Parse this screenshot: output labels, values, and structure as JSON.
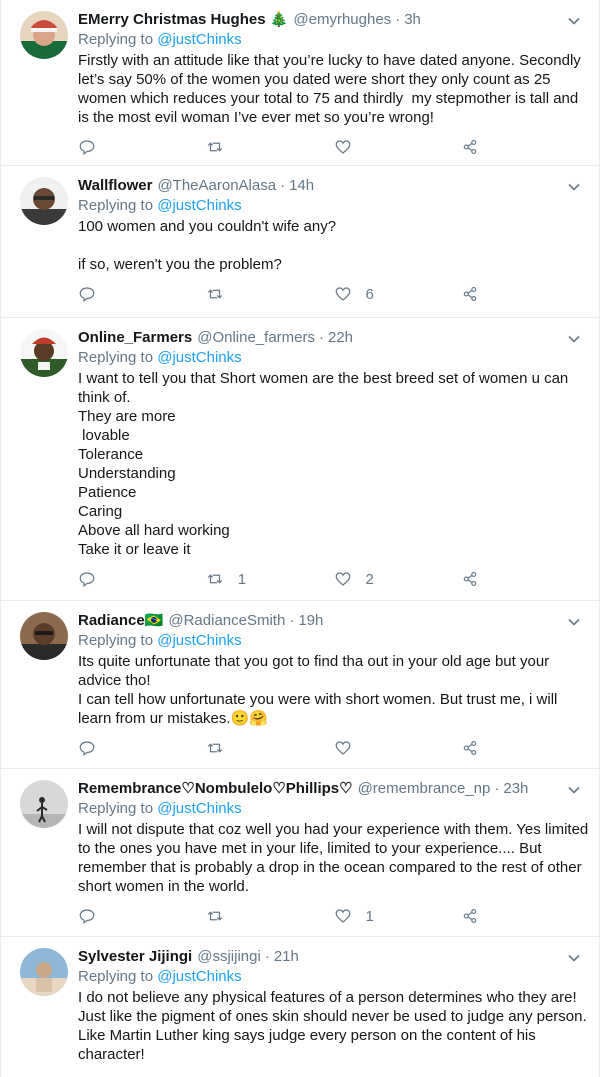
{
  "tweets": [
    {
      "name": "EMerry Christmas Hughes 🎄",
      "handle": "@emyrhughes",
      "time": "3h",
      "replying_prefix": "Replying to ",
      "replying_to": "@justChinks",
      "text": "Firstly with an attitude like that you’re lucky to have dated anyone. Secondly let’s say 50% of the women you dated were short they only count as 25 women which reduces your total to 75 and thirdly  my stepmother is tall and is the most evil woman I’ve ever met so you’re wrong!",
      "retweets": "",
      "likes": "",
      "avatar_colors": [
        "#1a6b3a",
        "#c94a3a",
        "#e8d5c0"
      ]
    },
    {
      "name": "Wallflower",
      "handle": "@TheAaronAlasa",
      "time": "14h",
      "replying_prefix": "Replying to ",
      "replying_to": "@justChinks",
      "text": "100 women and you couldn't wife any?\n\nif so, weren't you the problem?",
      "retweets": "",
      "likes": "6",
      "avatar_colors": [
        "#3a3a3a",
        "#9b9b9b",
        "#f0f0f0"
      ]
    },
    {
      "name": "Online_Farmers",
      "handle": "@Online_farmers",
      "time": "22h",
      "replying_prefix": "Replying to ",
      "replying_to": "@justChinks",
      "text": "I want to tell you that Short women are the best breed set of women u can think of.\nThey are more\n lovable\nTolerance\nUnderstanding\nPatience\nCaring\nAbove all hard working\nTake it or leave it",
      "retweets": "1",
      "likes": "2",
      "avatar_colors": [
        "#2d5a27",
        "#c0392b",
        "#f5f5f5"
      ]
    },
    {
      "name": "Radiance🇧🇷",
      "handle": "@RadianceSmith",
      "time": "19h",
      "replying_prefix": "Replying to ",
      "replying_to": "@justChinks",
      "text": "Its quite unfortunate that you got to find tha out in your old age but your advice tho!\nI can tell how unfortunate you were with short women. But trust me, i will learn from ur mistakes.🙂🤗",
      "retweets": "",
      "likes": "",
      "avatar_colors": [
        "#5a3e2b",
        "#8b6a4e",
        "#2a2a2a"
      ]
    },
    {
      "name": "Remembrance♡Nombulelo♡Phillips♡",
      "handle": "@remembrance_np",
      "time": "23h",
      "replying_prefix": "Replying to ",
      "replying_to": "@justChinks",
      "text": "I will not dispute that coz well you had your experience with them. Yes limited to the ones you have met in your life, limited to your experience.... But remember that is probably a drop in the ocean compared to the rest of other short women in the world.",
      "retweets": "",
      "likes": "1",
      "avatar_colors": [
        "#d8d8d8",
        "#b5b5b5",
        "#2a2a2a"
      ]
    },
    {
      "name": "Sylvester Jijingi",
      "handle": "@ssjijingi",
      "time": "21h",
      "replying_prefix": "Replying to ",
      "replying_to": "@justChinks",
      "text": "I do not believe any physical features of a person determines who they are! Just like the pigment of ones skin should never be used to judge any person. Like Martin Luther king says judge every person on the content of his character!",
      "retweets": "",
      "likes": "",
      "avatar_colors": [
        "#8fb8d8",
        "#c9a88a",
        "#e8d6c0"
      ]
    }
  ],
  "colors": {
    "link": "#1da1f2",
    "muted": "#657786",
    "border": "#e6ecf0"
  },
  "icons": [
    "reply-icon",
    "retweet-icon",
    "like-icon",
    "share-icon",
    "chevron-down-icon"
  ]
}
